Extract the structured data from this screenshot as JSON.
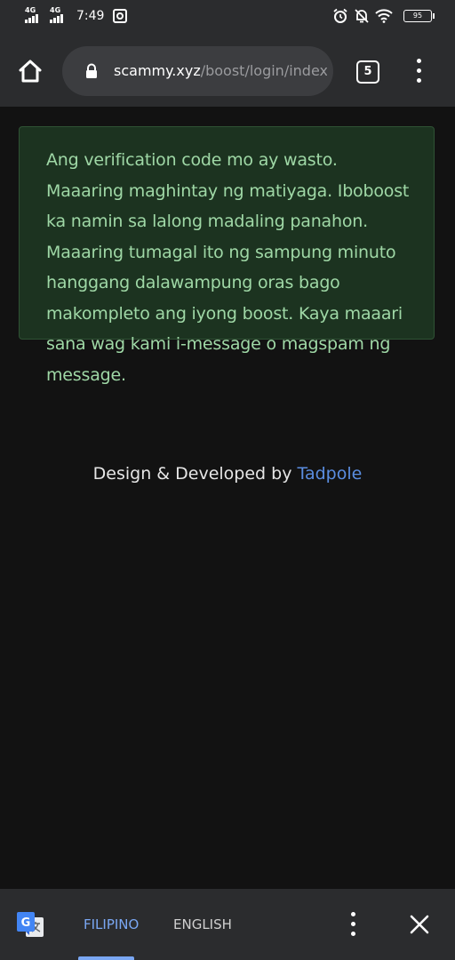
{
  "status_bar": {
    "network_1": "4G",
    "network_2": "4G",
    "time": "7:49",
    "battery_level": "95",
    "icons": [
      "signal-icon",
      "signal-icon",
      "instagram-icon",
      "alarm-icon",
      "mute-icon",
      "wifi-icon",
      "battery-icon"
    ]
  },
  "browser": {
    "url_domain": "scammy.xyz",
    "url_path": "/boost/login/index.p",
    "tab_count": "5",
    "icons": [
      "home-icon",
      "lock-icon",
      "tabs-icon",
      "more-vert-icon"
    ]
  },
  "content": {
    "alert_message": "Ang verification code mo ay wasto. Maaaring maghintay ng matiyaga. Iboboost ka namin sa lalong madaling panahon. Maaaring tumagal ito ng sampung minuto hanggang dalawampung oras bago makompleto ang iyong boost. Kaya maaari sana wag kami i-message o magspam ng message.",
    "credit_prefix": "Design & Developed by ",
    "credit_link": "Tadpole"
  },
  "translate_bar": {
    "source_language": "FILIPINO",
    "target_language": "ENGLISH",
    "selected": "FILIPINO",
    "icons": [
      "google-translate-icon",
      "more-vert-icon",
      "close-icon"
    ]
  },
  "colors": {
    "chrome_bg": "#2b2c2e",
    "page_bg": "#121212",
    "alert_bg": "#1c3320",
    "alert_text": "#9fd8a6",
    "link": "#5a8de0",
    "accent": "#7aa7f3"
  }
}
